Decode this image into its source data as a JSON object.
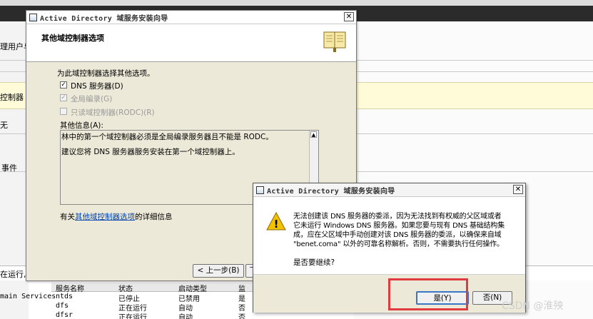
{
  "background": {
    "left_item_1": "理用户与",
    "left_item_2": "控制器",
    "left_item_3": "无",
    "left_item_4": "事件",
    "status_text": "在运行,",
    "table": {
      "headers": [
        "服务名称",
        "状态",
        "启动类型",
        "监"
      ],
      "rows": [
        {
          "left": "main Services",
          "name": "ntds",
          "status": "已停止",
          "start": "已禁用",
          "m": "是"
        },
        {
          "left": "",
          "name": "dfs",
          "status": "正在运行",
          "start": "自动",
          "m": "否"
        },
        {
          "left": "",
          "name": "dfsr",
          "status": "正在运行",
          "start": "自动",
          "m": "否"
        }
      ]
    }
  },
  "wizard": {
    "title": "Active Directory 域服务安装向导",
    "close_glyph": "✕",
    "header_title": "其他域控制器选项",
    "prompt": "为此域控制器选择其他选项。",
    "options": [
      {
        "label": "DNS 服务器(D)",
        "checked": true,
        "enabled": true
      },
      {
        "label": "全局编录(G)",
        "checked": true,
        "enabled": false
      },
      {
        "label": "只读域控制器(RODC)(R)",
        "checked": false,
        "enabled": false
      }
    ],
    "info_label": "其他信息(A):",
    "info_line_1": "林中的第一个域控制器必须是全局编录服务器且不能是 RODC。",
    "info_line_2": "建议您将 DNS 服务器服务安装在第一个域控制器上。",
    "more_prefix": "有关",
    "more_link": "其他域控制器选项",
    "more_suffix": "的详细信息",
    "back_button": "< 上一步(B)",
    "next_button_partial": "下"
  },
  "alert": {
    "title": "Active Directory 域服务安装向导",
    "close_glyph": "✕",
    "message": "无法创建该 DNS 服务器的委派，因为无法找到有权威的父区域或者它未运行 Windows DNS 服务器。如果您要与现有 DNS 基础结构集成，应在父区域中手动创建对该 DNS 服务器的委派，以确保来自域 \"benet.coma\" 以外的可靠名称解析。否则，不需要执行任何操作。",
    "question": "是否要继续?",
    "yes_button": "是(Y)",
    "no_button": "否(N)",
    "warning_glyph": "!"
  },
  "watermark": "CSDN @淮殃",
  "colors": {
    "highlight": "#e0393e",
    "link": "#0645ad",
    "warning": "#f2c200"
  }
}
